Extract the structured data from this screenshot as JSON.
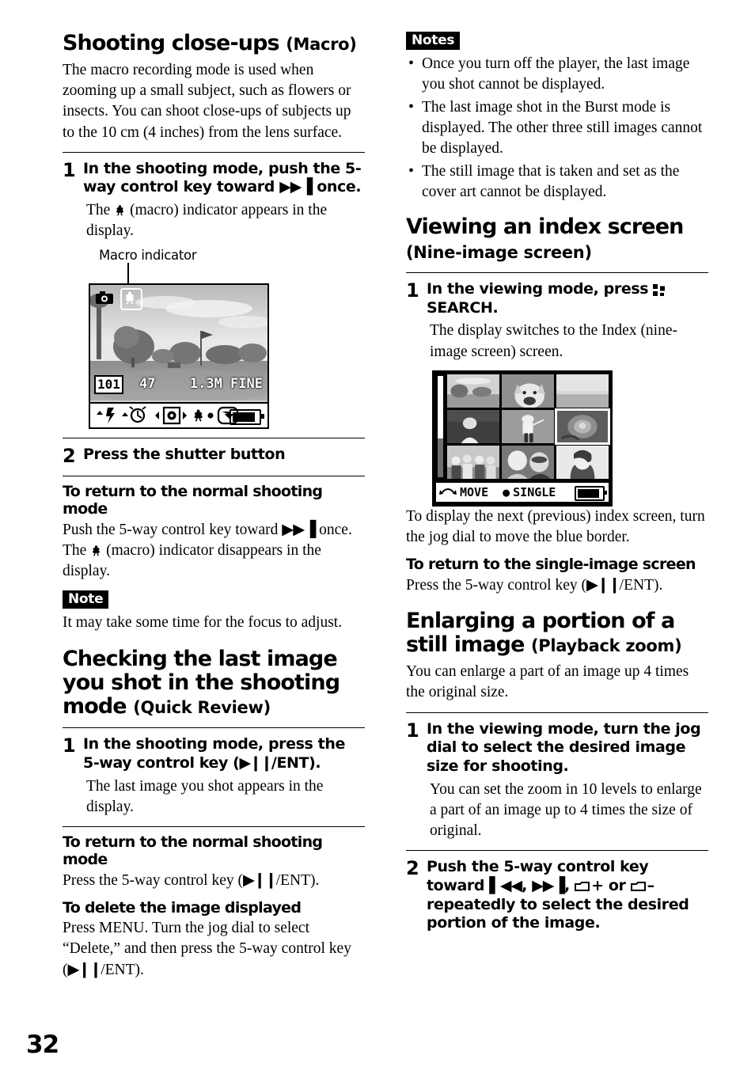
{
  "page_number": "32",
  "left_column": {
    "section1": {
      "title": "Shooting close-ups",
      "title_paren": "(Macro)",
      "intro": "The macro recording mode is used when zooming up a small subject, such as flowers or insects. You can shoot close-ups of subjects up to the 10 cm (4 inches) from the lens surface.",
      "step1": {
        "number": "1",
        "title_a": "In the shooting mode, push the 5-way control key toward ",
        "title_b": " once.",
        "desc_a": "The ",
        "desc_b": " (macro) indicator appears in the display."
      },
      "figure": {
        "callout": "Macro indicator",
        "folder": "101",
        "count": "47",
        "quality": "1.3M FINE"
      },
      "step2": {
        "number": "2",
        "title": "Press the shutter button"
      },
      "return_heading": "To return to the normal shooting mode",
      "return_text_a": "Push the 5-way control key toward ",
      "return_text_b": " once. The ",
      "return_text_c": " (macro) indicator disappears in the display.",
      "note_badge": "Note",
      "note_text": "It may take some time for the focus to adjust."
    },
    "section2": {
      "title": "Checking the last image you shot in the shooting mode",
      "title_paren": "(Quick Review)",
      "step1": {
        "number": "1",
        "title_a": "In the shooting mode, press the 5-way control key (",
        "title_b": "/ENT).",
        "desc": "The last image you shot appears in the display."
      },
      "return_heading": "To return to the normal shooting mode",
      "return_text_a": "Press the 5-way control key (",
      "return_text_b": "/ENT).",
      "delete_heading": "To delete the image displayed",
      "delete_text_a": "Press MENU. Turn the jog dial to select “Delete,” and then press the 5-way control key (",
      "delete_text_b": "/ENT)."
    }
  },
  "right_column": {
    "notes_badge": "Notes",
    "notes": [
      "Once you turn off the player, the last image you shot cannot be displayed.",
      "The last image shot in the Burst mode is displayed. The other three still images cannot be displayed.",
      "The still image that is taken and set as the cover art cannot be displayed."
    ],
    "section1": {
      "title": "Viewing an index screen",
      "title_sub": "(Nine-image screen)",
      "step1": {
        "number": "1",
        "title_a": "In the viewing mode, press ",
        "title_b": " SEARCH.",
        "desc": "The display switches to the Index (nine-image screen) screen."
      },
      "figure": {
        "move_label": "MOVE",
        "single_label": "SINGLE"
      },
      "after_figure": "To display the next (previous) index screen, turn the jog dial to move the blue border.",
      "return_heading": "To return to the single-image screen",
      "return_text_a": "Press the 5-way control key (",
      "return_text_b": "/ENT)."
    },
    "section2": {
      "title": "Enlarging a portion of a still image",
      "title_paren": "(Playback zoom)",
      "intro": "You can enlarge a part of an image up 4 times the original size.",
      "step1": {
        "number": "1",
        "title": "In the viewing mode, turn the jog dial to select the desired image size for shooting.",
        "desc": "You can set the zoom in 10 levels to enlarge a part of an image up to 4 times the size of original."
      },
      "step2": {
        "number": "2",
        "title_a": "Push the 5-way control key toward ",
        "title_b": ", ",
        "title_c": ",  ",
        "title_d": "+ or  ",
        "title_e": "– repeatedly to select the desired portion of the image."
      }
    }
  }
}
